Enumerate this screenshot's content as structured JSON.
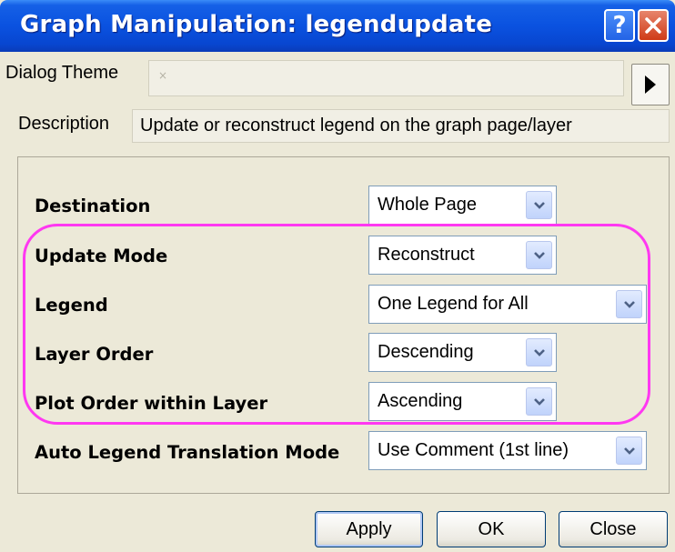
{
  "window": {
    "title": "Graph Manipulation: legendupdate",
    "help_label": "?"
  },
  "theme": {
    "label": "Dialog Theme",
    "value": "×"
  },
  "description": {
    "label": "Description",
    "value": "Update or reconstruct legend on the graph page/layer"
  },
  "settings": {
    "destination": {
      "label": "Destination",
      "value": "Whole Page"
    },
    "update_mode": {
      "label": "Update Mode",
      "value": "Reconstruct"
    },
    "legend": {
      "label": "Legend",
      "value": "One Legend for All"
    },
    "layer_order": {
      "label": "Layer Order",
      "value": "Descending"
    },
    "plot_order": {
      "label": "Plot Order within Layer",
      "value": "Ascending"
    },
    "translation_mode": {
      "label": "Auto Legend Translation Mode",
      "value": "Use Comment (1st line)"
    }
  },
  "buttons": {
    "apply": "Apply",
    "ok": "OK",
    "close": "Close"
  },
  "colors": {
    "title_bar": "#0a52e0",
    "highlight": "#ff38f1",
    "dialog_bg": "#ece9d8"
  }
}
